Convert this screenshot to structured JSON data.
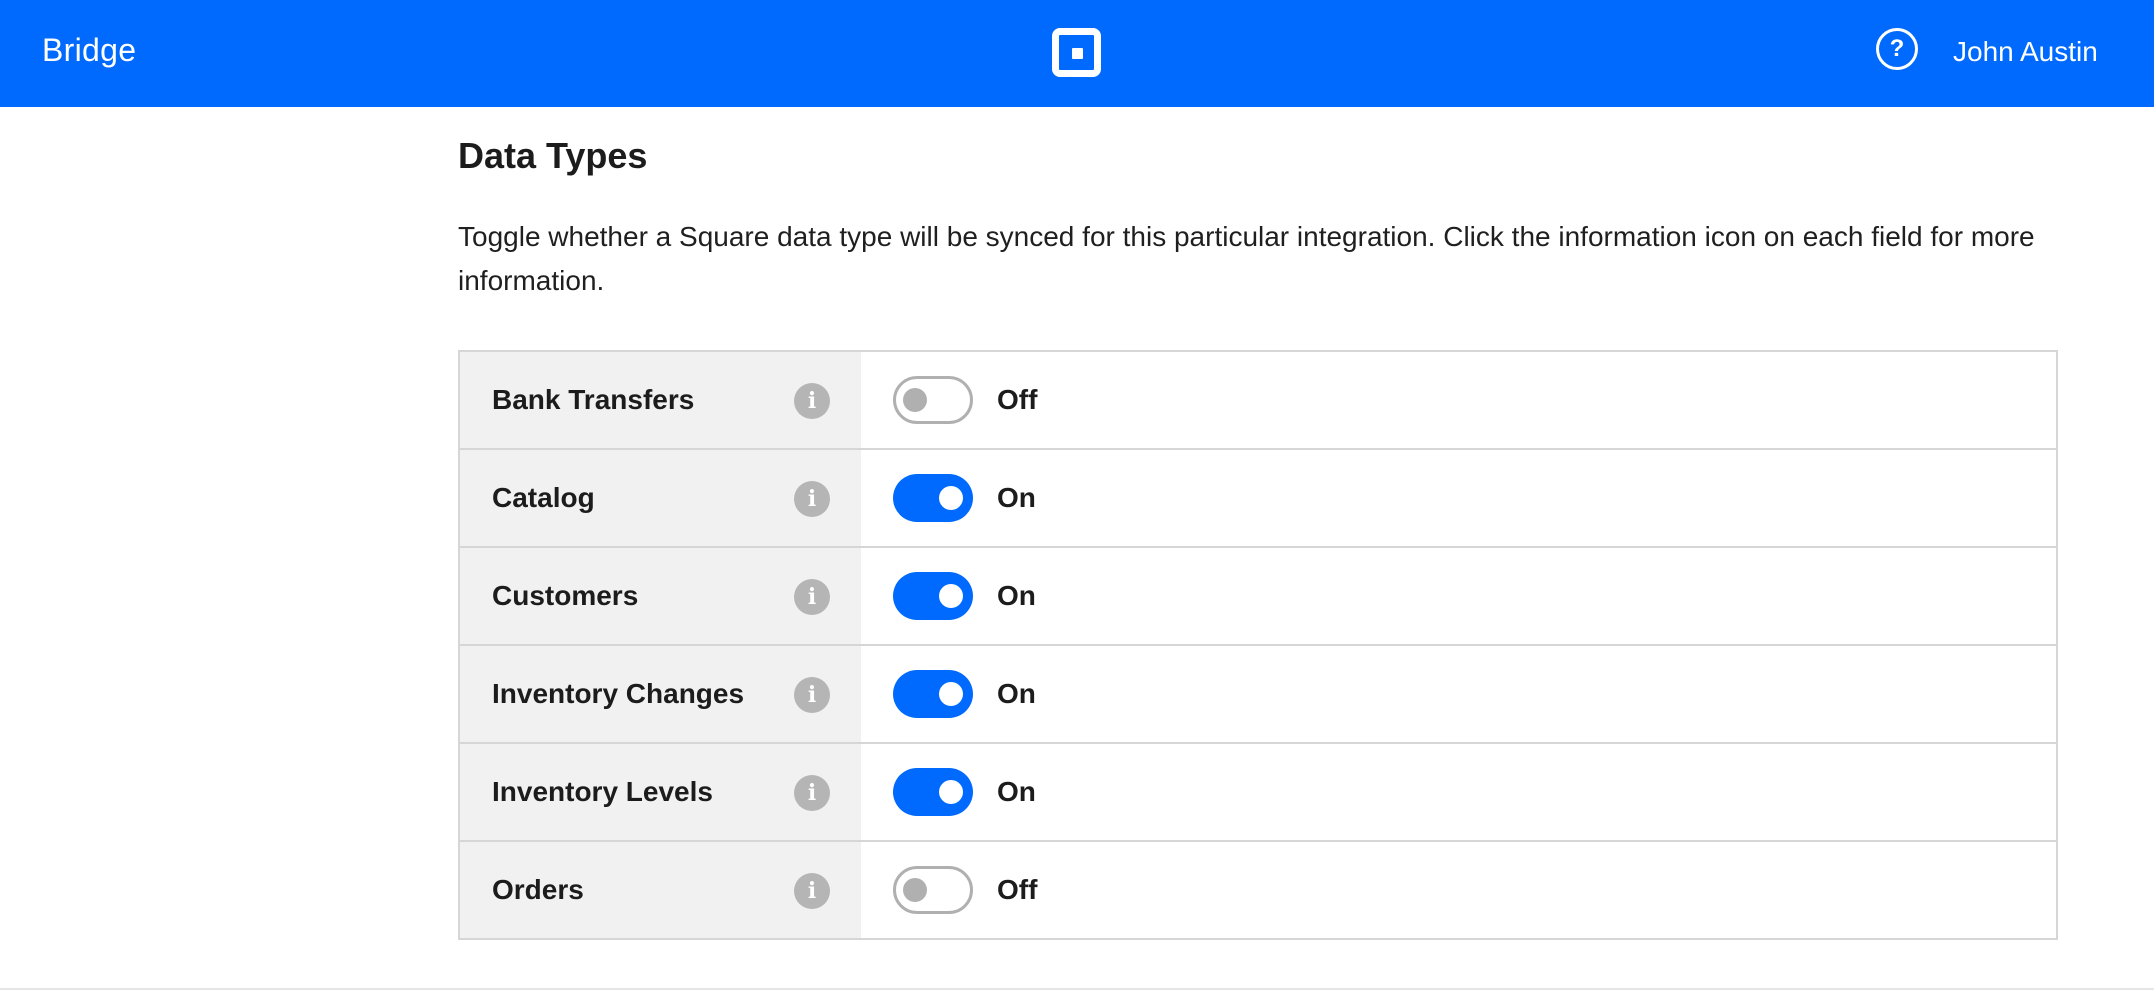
{
  "app": {
    "name": "Bridge"
  },
  "header": {
    "logo_icon": "square-logo-icon",
    "help_icon": "help-circle-icon",
    "user_name": "John Austin",
    "background_color": "#006aff"
  },
  "section": {
    "title": "Data Types",
    "description": "Toggle whether a Square data type will be synced for this particular integration. Click the information icon on each field for more information."
  },
  "data_types": [
    {
      "label": "Bank Transfers",
      "enabled": false,
      "state_label": "Off",
      "info_icon": "info-icon"
    },
    {
      "label": "Catalog",
      "enabled": true,
      "state_label": "On",
      "info_icon": "info-icon"
    },
    {
      "label": "Customers",
      "enabled": true,
      "state_label": "On",
      "info_icon": "info-icon"
    },
    {
      "label": "Inventory Changes",
      "enabled": true,
      "state_label": "On",
      "info_icon": "info-icon"
    },
    {
      "label": "Inventory Levels",
      "enabled": true,
      "state_label": "On",
      "info_icon": "info-icon"
    },
    {
      "label": "Orders",
      "enabled": false,
      "state_label": "Off",
      "info_icon": "info-icon"
    }
  ],
  "colors": {
    "accent": "#006aff",
    "toggle_off": "#b0b0b0",
    "label_cell_bg": "#f1f1f1",
    "border": "#d6d6d6"
  }
}
